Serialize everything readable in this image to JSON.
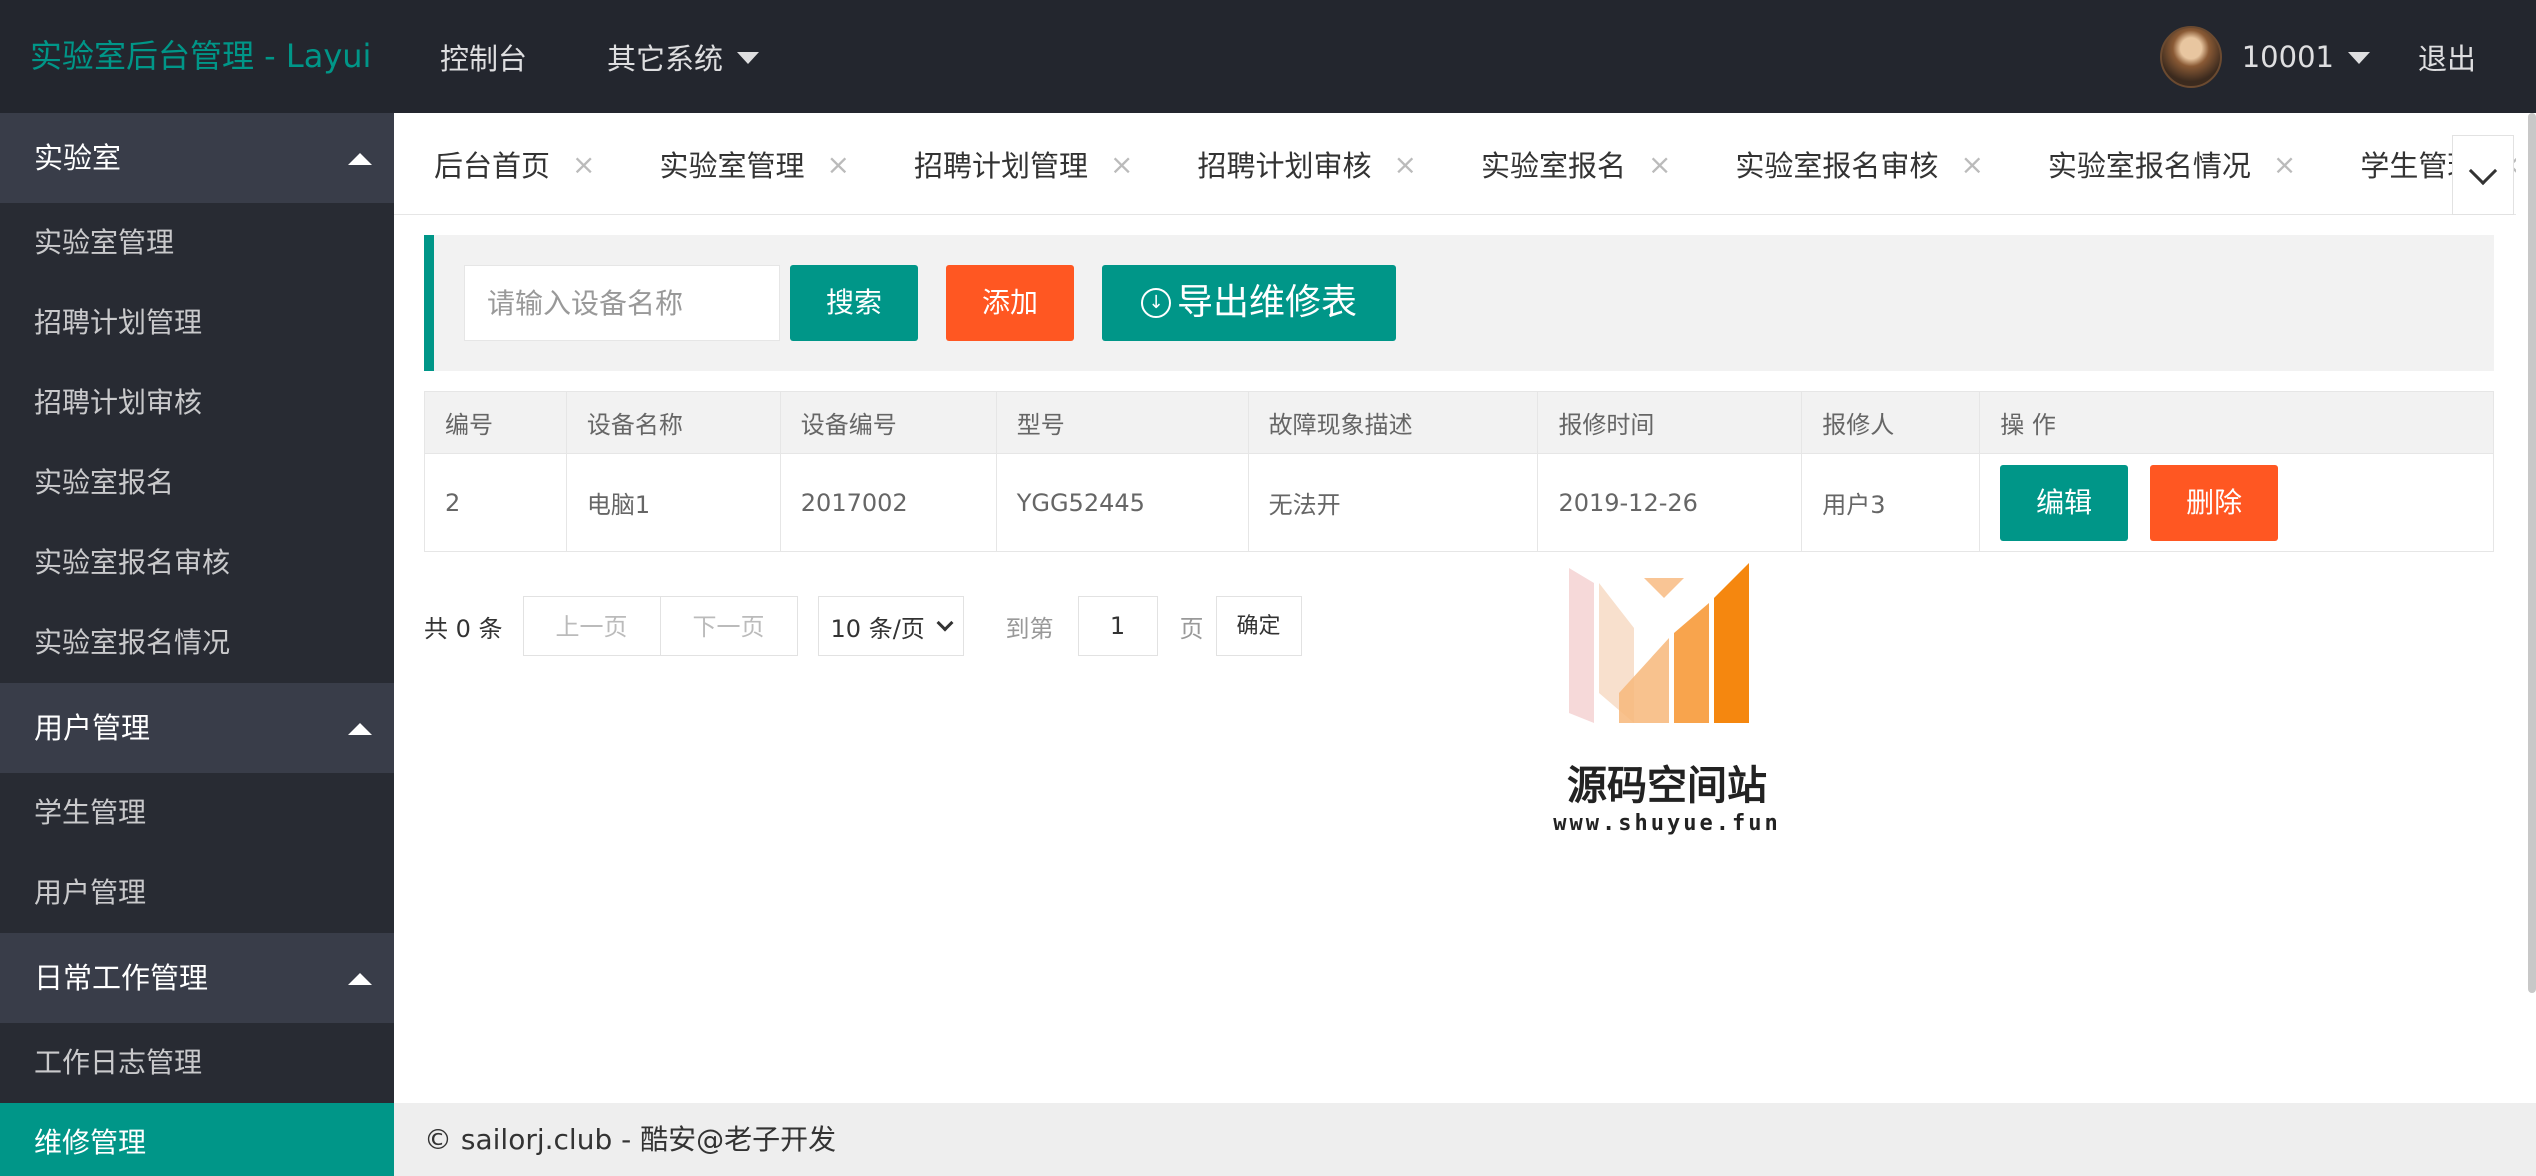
{
  "app": {
    "title": "实验室后台管理 - Layui"
  },
  "topnav": {
    "items": [
      {
        "label": "控制台"
      },
      {
        "label": "其它系统"
      }
    ],
    "user": {
      "name": "10001"
    },
    "logout_label": "退出"
  },
  "sidebar": {
    "groups": [
      {
        "title": "实验室",
        "items": [
          "实验室管理",
          "招聘计划管理",
          "招聘计划审核",
          "实验室报名",
          "实验室报名审核",
          "实验室报名情况"
        ]
      },
      {
        "title": "用户管理",
        "items": [
          "学生管理",
          "用户管理"
        ]
      },
      {
        "title": "日常工作管理",
        "items": [
          "工作日志管理",
          "维修管理"
        ]
      }
    ],
    "active_item": "维修管理"
  },
  "tabs": [
    {
      "label": "后台首页",
      "close": "×"
    },
    {
      "label": "实验室管理",
      "close": "×"
    },
    {
      "label": "招聘计划管理",
      "close": "×"
    },
    {
      "label": "招聘计划审核",
      "close": "×"
    },
    {
      "label": "实验室报名",
      "close": "×"
    },
    {
      "label": "实验室报名审核",
      "close": "×"
    },
    {
      "label": "实验室报名情况",
      "close": "×"
    },
    {
      "label": "学生管理",
      "close": "×"
    }
  ],
  "toolbar": {
    "search_placeholder": "请输入设备名称",
    "search_value": "",
    "search_label": "搜索",
    "add_label": "添加",
    "export_label": "导出维修表",
    "export_icon": "download-circle-icon"
  },
  "table": {
    "headers": [
      "编号",
      "设备名称",
      "设备编号",
      "型号",
      "故障现象描述",
      "报修时间",
      "报修人",
      "操 作"
    ],
    "rows": [
      [
        "2",
        "电脑1",
        "2017002",
        "YGG52445",
        "无法开",
        "2019-12-26",
        "用户3"
      ]
    ],
    "edit_label": "编辑",
    "delete_label": "删除"
  },
  "pager": {
    "count": "共 0 条",
    "prev": "上一页",
    "next": "下一页",
    "page_size": "10 条/页",
    "skip": "到第",
    "page_value": "1",
    "page_unit": "页",
    "confirm": "确定"
  },
  "watermark": {
    "text": "源码空间站",
    "url": "www.shuyue.fun"
  },
  "footer": {
    "text": "© sailorj.club - 酷安@老子开发"
  },
  "colors": {
    "header_bg": "#23262e",
    "sidebar_bg": "#393d49",
    "sidebar_sub_bg": "#282b33",
    "accent": "#009688",
    "danger": "#ff5722"
  }
}
